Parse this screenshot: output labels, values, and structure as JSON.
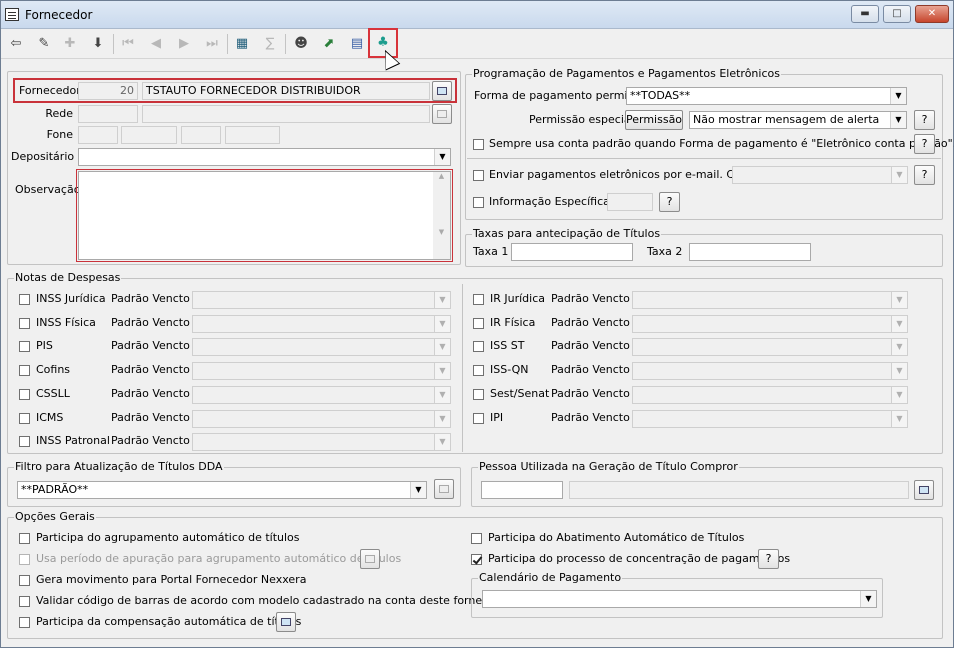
{
  "window": {
    "title": "Fornecedor",
    "minimize": "▬",
    "maximize": "□",
    "close": "✕"
  },
  "toolbar": {
    "tools": [
      {
        "name": "exit-icon",
        "glyph": "⇦"
      },
      {
        "name": "edit-icon",
        "glyph": "✎"
      },
      {
        "name": "add-icon",
        "glyph": "✚"
      },
      {
        "name": "save-icon",
        "glyph": "⬇"
      },
      {
        "name": "first-icon",
        "glyph": "⏮"
      },
      {
        "name": "prev-icon",
        "glyph": "◀"
      },
      {
        "name": "next-icon",
        "glyph": "▶"
      },
      {
        "name": "last-icon",
        "glyph": "⏭"
      },
      {
        "name": "film-icon",
        "glyph": "▦"
      },
      {
        "name": "calc-icon",
        "glyph": "∑"
      },
      {
        "name": "person-icon",
        "glyph": "☻"
      },
      {
        "name": "export-icon",
        "glyph": "⬈"
      },
      {
        "name": "document-icon",
        "glyph": "▤"
      },
      {
        "name": "clover-icon",
        "glyph": "♣"
      }
    ]
  },
  "left": {
    "fornecedor_label": "Fornecedor",
    "fornecedor_code": "20",
    "fornecedor_name": "TSTAUTO FORNECEDOR DISTRIBUIDOR",
    "rede_label": "Rede",
    "fone_label": "Fone",
    "depositario_label": "Depositário",
    "observacao_label": "Observação"
  },
  "pagamentos": {
    "title": "Programação de Pagamentos e Pagamentos Eletrônicos",
    "forma_label": "Forma de pagamento permitida",
    "forma_value": "**TODAS**",
    "permissao_label": "Permissão especial",
    "permissao_button": "Permissão",
    "alerta_value": "Não mostrar mensagem de alerta",
    "help": "?",
    "conta_padrao": "Sempre usa conta padrão quando Forma de pagamento é \"Eletrônico conta padrão\".",
    "enviar_email": "Enviar pagamentos eletrônicos por e-mail. Contato:",
    "info_especifica": "Informação Específica"
  },
  "taxas": {
    "title": "Taxas para antecipação de Títulos",
    "taxa1": "Taxa 1",
    "taxa2": "Taxa 2"
  },
  "notas": {
    "title": "Notas de Despesas",
    "padrao": "Padrão Vencto",
    "left": [
      "INSS Jurídica",
      "INSS Física",
      "PIS",
      "Cofins",
      "CSSLL",
      "ICMS",
      "INSS Patronal"
    ],
    "right": [
      "IR Jurídica",
      "IR Física",
      "ISS ST",
      "ISS-QN",
      "Sest/Senat",
      "IPI"
    ]
  },
  "dda": {
    "title": "Filtro para Atualização de Títulos DDA",
    "value": "**PADRÃO**"
  },
  "pessoa": {
    "title": "Pessoa Utilizada na Geração de Título Compror"
  },
  "opcoes": {
    "title": "Opções Gerais",
    "left": [
      {
        "label": "Participa do agrupamento automático de títulos",
        "checked": false,
        "disabled": false
      },
      {
        "label": "Usa período de apuração para agrupamento automático de títulos",
        "checked": false,
        "disabled": true
      },
      {
        "label": "Gera movimento para Portal Fornecedor Nexxera",
        "checked": false,
        "disabled": false
      },
      {
        "label": "Validar código de barras de acordo com modelo cadastrado na conta deste fornecedor",
        "checked": false,
        "disabled": false
      },
      {
        "label": "Participa da compensação automática de títulos",
        "checked": false,
        "disabled": false
      }
    ],
    "abatimento": "Participa do Abatimento Automático de Títulos",
    "concentracao": "Participa do processo de concentração de pagamentos",
    "calendario_title": "Calendário de Pagamento"
  }
}
